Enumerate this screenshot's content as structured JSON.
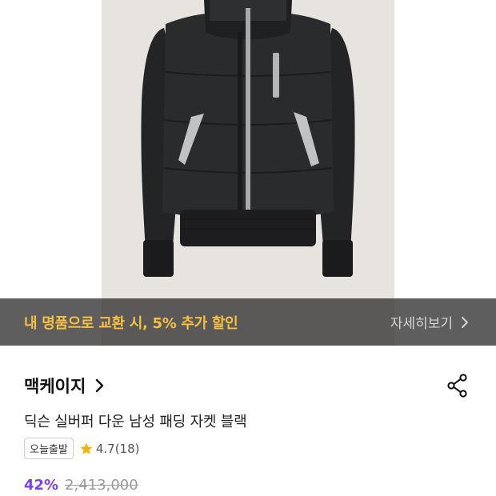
{
  "promo": {
    "text": "내 명품으로 교환 시, 5% 추가 할인",
    "link_label": "자세히보기"
  },
  "product": {
    "brand": "맥케이지",
    "title": "딕슨 실버퍼 다운 남성 패딩 자켓 블랙",
    "badge": "오늘출발",
    "rating": "4.7",
    "review_count": "(18)",
    "discount": "42%",
    "original_price": "2,413,000"
  },
  "colors": {
    "promo_text": "#f6c043",
    "discount": "#7b3ff2",
    "star": "#f5b400"
  },
  "icons": [
    "chevron-right-icon",
    "share-icon",
    "star-icon"
  ]
}
